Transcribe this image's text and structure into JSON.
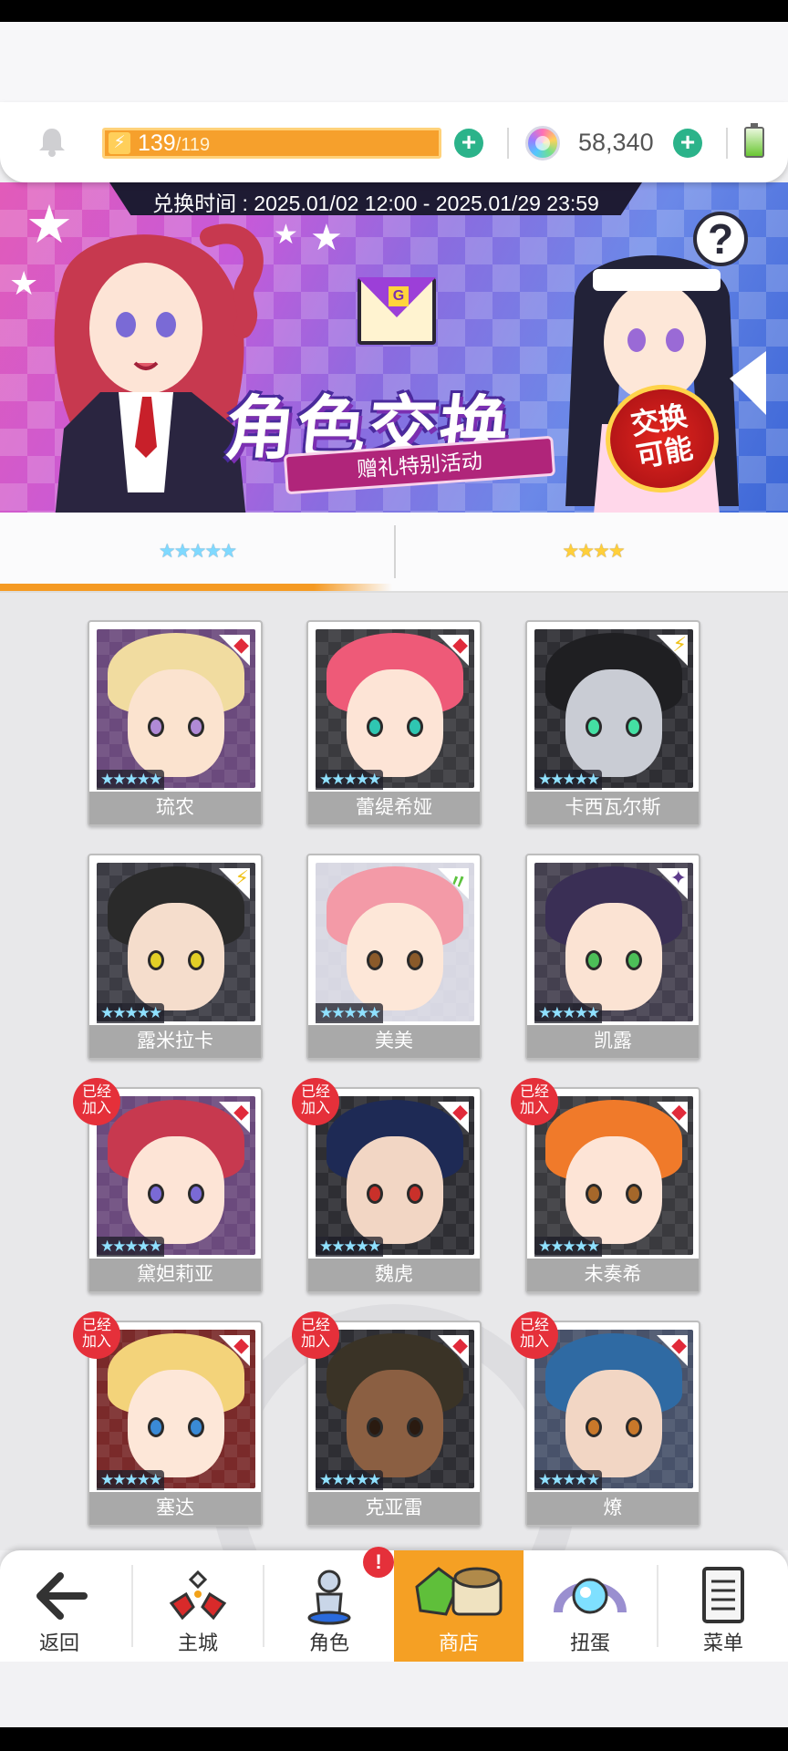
{
  "header": {
    "stamina_current": "139",
    "stamina_max": "/119",
    "gems": "58,340",
    "stamina_add_label": "+",
    "gem_add_label": "+"
  },
  "banner": {
    "period": "兑换时间 : 2025.01/02 12:00 - 2025.01/29 23:59",
    "title": "角色交换",
    "subtitle": "赠礼特别活动",
    "badge_line1": "交换",
    "badge_line2": "可能",
    "help_label": "?"
  },
  "tabs": [
    {
      "label": "★★★★★",
      "rarity": 5,
      "selected": true
    },
    {
      "label": "★★★★",
      "rarity": 4,
      "selected": false
    }
  ],
  "joined_label_line1": "已经",
  "joined_label_line2": "加入",
  "cards": [
    {
      "name": "琉农",
      "stars": "★★★★★",
      "element": "fire",
      "element_glyph": "◆",
      "element_color": "#e12a3a",
      "joined": false,
      "hair": "#f1dca0",
      "skin": "#fbe3cf",
      "bg": "#6b4a7d",
      "eye": "#b08ad6"
    },
    {
      "name": "蕾缇希娅",
      "stars": "★★★★★",
      "element": "fire",
      "element_glyph": "◆",
      "element_color": "#e12a3a",
      "joined": false,
      "hair": "#ee5a78",
      "skin": "#fde4d6",
      "bg": "#3a3a3e",
      "eye": "#2fc6b2"
    },
    {
      "name": "卡西瓦尔斯",
      "stars": "★★★★★",
      "element": "thunder",
      "element_glyph": "⚡",
      "element_color": "#f0c21a",
      "joined": false,
      "hair": "#1f1f22",
      "skin": "#c9ccd4",
      "bg": "#2e2e33",
      "eye": "#44e0a3"
    },
    {
      "name": "露米拉卡",
      "stars": "★★★★★",
      "element": "thunder",
      "element_glyph": "⚡",
      "element_color": "#f0c21a",
      "joined": false,
      "hair": "#2a2a2a",
      "skin": "#f5ddcc",
      "bg": "#3c3c44",
      "eye": "#e2cf26"
    },
    {
      "name": "美美",
      "stars": "★★★★★",
      "element": "wind",
      "element_glyph": "〃",
      "element_color": "#5bc23d",
      "joined": false,
      "hair": "#f39aa7",
      "skin": "#fde7d8",
      "bg": "#d7d7e2",
      "eye": "#8a5a2a"
    },
    {
      "name": "凯露",
      "stars": "★★★★★",
      "element": "dark",
      "element_glyph": "✦",
      "element_color": "#5c3b8a",
      "joined": false,
      "hair": "#3a2f55",
      "skin": "#fbe3d3",
      "bg": "#44404f",
      "eye": "#4cbf58"
    },
    {
      "name": "黛妲莉亚",
      "stars": "★★★★★",
      "element": "fire",
      "element_glyph": "◆",
      "element_color": "#e12a3a",
      "joined": true,
      "hair": "#c7394f",
      "skin": "#fde4d6",
      "bg": "#6b4a7d",
      "eye": "#7a6ad6"
    },
    {
      "name": "魏虎",
      "stars": "★★★★★",
      "element": "fire",
      "element_glyph": "◆",
      "element_color": "#e12a3a",
      "joined": true,
      "hair": "#1e2a55",
      "skin": "#f2d6c4",
      "bg": "#2e2e33",
      "eye": "#c9302a"
    },
    {
      "name": "未奏希",
      "stars": "★★★★★",
      "element": "fire",
      "element_glyph": "◆",
      "element_color": "#e12a3a",
      "joined": true,
      "hair": "#f07a2a",
      "skin": "#fde4d6",
      "bg": "#3a3a3e",
      "eye": "#a5672a"
    },
    {
      "name": "塞达",
      "stars": "★★★★★",
      "element": "fire",
      "element_glyph": "◆",
      "element_color": "#e12a3a",
      "joined": true,
      "hair": "#f3d37a",
      "skin": "#fde7d8",
      "bg": "#7a2a2a",
      "eye": "#3a8ad6"
    },
    {
      "name": "克亚雷",
      "stars": "★★★★★",
      "element": "fire",
      "element_glyph": "◆",
      "element_color": "#e12a3a",
      "joined": true,
      "hair": "#3a3326",
      "skin": "#8b5f42",
      "bg": "#2e2e33",
      "eye": "#2a1a10"
    },
    {
      "name": "燎",
      "stars": "★★★★★",
      "element": "fire",
      "element_glyph": "◆",
      "element_color": "#e12a3a",
      "joined": true,
      "hair": "#2f6aa3",
      "skin": "#f2d6c4",
      "bg": "#48526a",
      "eye": "#c8782a"
    }
  ],
  "nav": [
    {
      "label": "返回",
      "icon": "back-arrow-icon"
    },
    {
      "label": "主城",
      "icon": "castle-icon"
    },
    {
      "label": "角色",
      "icon": "character-icon"
    },
    {
      "label": "商店",
      "icon": "shop-icon"
    },
    {
      "label": "扭蛋",
      "icon": "gacha-icon"
    },
    {
      "label": "菜单",
      "icon": "menu-icon"
    }
  ],
  "nav_alert": "!",
  "colors": {
    "accent": "#f5a024",
    "stamina": "#f6a02c",
    "plus": "#2bb38a",
    "badge_red": "#e5303a"
  }
}
